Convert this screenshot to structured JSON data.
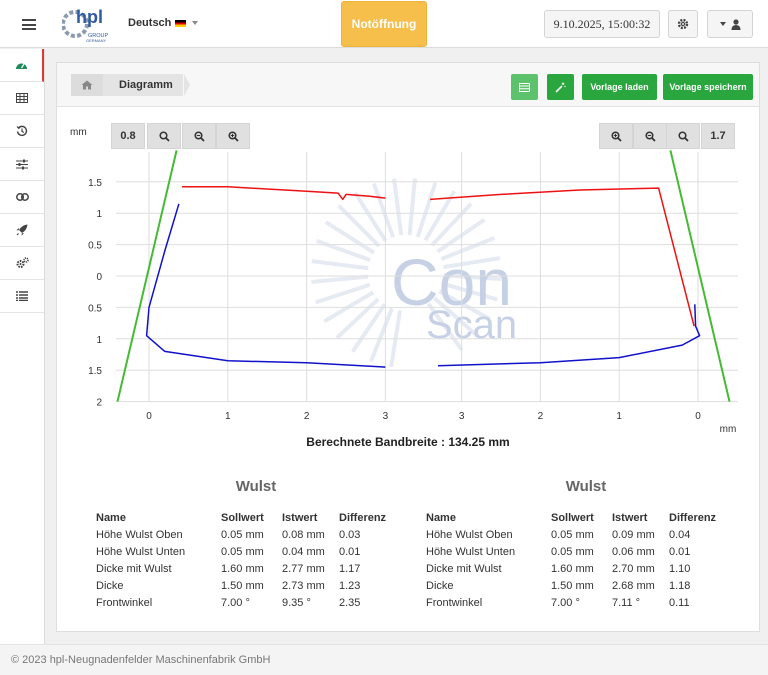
{
  "header": {
    "logo_text": "hpl",
    "logo_sub": "GROUP",
    "logo_sub2": "GERMANY",
    "language": "Deutsch",
    "emergency_label": "Notöffnung",
    "datetime": "9.10.2025, 15:00:32"
  },
  "sidebar": {
    "items": [
      {
        "icon": "dashboard-icon",
        "active": true
      },
      {
        "icon": "table-icon",
        "active": false
      },
      {
        "icon": "history-icon",
        "active": false
      },
      {
        "icon": "sliders-icon",
        "active": false
      },
      {
        "icon": "link-icon",
        "active": false
      },
      {
        "icon": "rocket-icon",
        "active": false
      },
      {
        "icon": "cogs-icon",
        "active": false
      },
      {
        "icon": "list-icon",
        "active": false
      }
    ]
  },
  "breadcrumb": {
    "title": "Diagramm"
  },
  "toolbar": {
    "load_label": "Vorlage laden",
    "save_label": "Vorlage speichern"
  },
  "zoom": {
    "unit_left": "mm",
    "unit_right": "mm",
    "left_value": "0.8",
    "right_value": "1.7"
  },
  "watermark": {
    "line1": "Con",
    "line2": "Scan"
  },
  "chart_data": {
    "type": "line",
    "y_ticks": [
      "1.5",
      "1",
      "0.5",
      "0",
      "0.5",
      "1",
      "1.5",
      "2"
    ],
    "x_ticks_left": [
      "0",
      "1",
      "2",
      "3"
    ],
    "x_ticks_right": [
      "3",
      "2",
      "1",
      "0"
    ],
    "xlabel": "mm",
    "colors": {
      "top": "#ee1111",
      "bottom": "#1111cc",
      "guide": "#44bb33"
    },
    "series": [
      {
        "side": "left",
        "color": "red",
        "x": [
          0.42,
          1.0,
          2.0,
          2.4,
          2.46,
          2.5,
          2.8,
          3.0
        ],
        "y": [
          1.42,
          1.42,
          1.35,
          1.32,
          1.22,
          1.3,
          1.27,
          1.24
        ]
      },
      {
        "side": "left",
        "color": "blue",
        "x": [
          0.38,
          0.2,
          0.0,
          -0.03,
          0.2,
          1.0,
          2.0,
          3.0
        ],
        "y": [
          1.15,
          0.4,
          -0.5,
          -0.95,
          -1.2,
          -1.35,
          -1.38,
          -1.45
        ]
      },
      {
        "side": "right",
        "color": "red",
        "x": [
          3.4,
          2.5,
          1.5,
          0.5,
          0.05
        ],
        "y": [
          1.22,
          1.3,
          1.37,
          1.4,
          -0.8
        ]
      },
      {
        "side": "right",
        "color": "blue",
        "x": [
          0.04,
          0.03,
          -0.02,
          0.2,
          1.0,
          2.0,
          3.3
        ],
        "y": [
          -0.45,
          -0.8,
          -0.95,
          -1.1,
          -1.3,
          -1.38,
          -1.43
        ]
      }
    ],
    "guides": [
      {
        "side": "left",
        "x": [
          -0.4,
          0.35
        ],
        "y": [
          -2.0,
          2.0
        ]
      },
      {
        "side": "right",
        "x": [
          -0.4,
          0.35
        ],
        "y": [
          -2.0,
          2.0
        ]
      }
    ]
  },
  "bandwidth_label": "Berechnete Bandbreite : 134.25 mm",
  "tables": [
    {
      "title": "Wulst",
      "headers": [
        "Name",
        "Sollwert",
        "Istwert",
        "Differenz"
      ],
      "rows": [
        [
          "Höhe Wulst Oben",
          "0.05 mm",
          "0.08 mm",
          "0.03"
        ],
        [
          "Höhe Wulst Unten",
          "0.05 mm",
          "0.04 mm",
          "0.01"
        ],
        [
          "Dicke mit Wulst",
          "1.60 mm",
          "2.77 mm",
          "1.17"
        ],
        [
          "Dicke",
          "1.50 mm",
          "2.73 mm",
          "1.23"
        ],
        [
          "Frontwinkel",
          "7.00 °",
          "9.35 °",
          "2.35"
        ]
      ]
    },
    {
      "title": "Wulst",
      "headers": [
        "Name",
        "Sollwert",
        "Istwert",
        "Differenz"
      ],
      "rows": [
        [
          "Höhe Wulst Oben",
          "0.05 mm",
          "0.09 mm",
          "0.04"
        ],
        [
          "Höhe Wulst Unten",
          "0.05 mm",
          "0.06 mm",
          "0.01"
        ],
        [
          "Dicke mit Wulst",
          "1.60 mm",
          "2.70 mm",
          "1.10"
        ],
        [
          "Dicke",
          "1.50 mm",
          "2.68 mm",
          "1.18"
        ],
        [
          "Frontwinkel",
          "7.00 °",
          "7.11 °",
          "0.11"
        ]
      ]
    }
  ],
  "footer": {
    "text": "© 2023 hpl-Neugnadenfelder Maschinenfabrik GmbH"
  }
}
